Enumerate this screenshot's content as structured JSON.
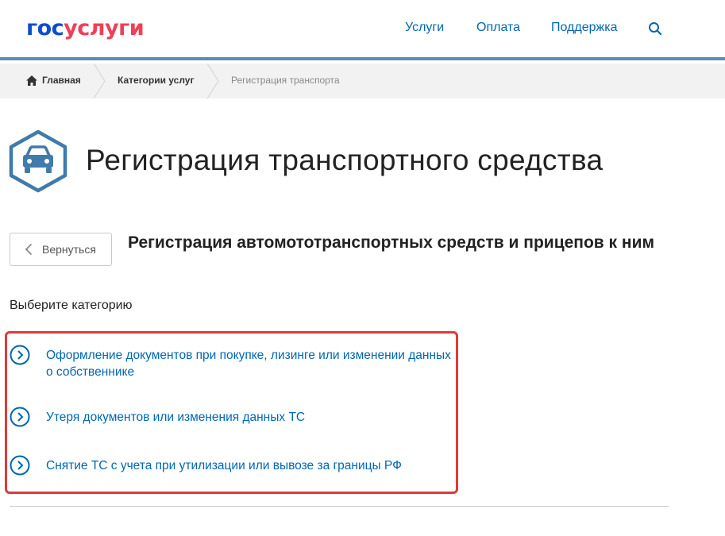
{
  "header": {
    "logo": {
      "part1": "гос",
      "part2": "услуги"
    },
    "nav": [
      "Услуги",
      "Оплата",
      "Поддержка"
    ]
  },
  "breadcrumb": {
    "home": "Главная",
    "categories": "Категории услуг",
    "current": "Регистрация транспорта"
  },
  "page": {
    "title": "Регистрация транспортного средства",
    "back_label": "Вернуться",
    "subtitle": "Регистрация автомототранспортных средств и прицепов к ним",
    "choose_label": "Выберите категорию",
    "categories": [
      "Оформление документов при покупке, лизинге или изменении данных о собственнике",
      "Утеря документов или изменения данных ТС",
      "Снятие ТС с учета при утилизации или вывозе за границы РФ"
    ]
  },
  "colors": {
    "brand_blue": "#0d4cd3",
    "brand_red": "#ee3f58",
    "link": "#0066b3",
    "icon": "#3f7bab",
    "highlight": "#e03a3a"
  }
}
